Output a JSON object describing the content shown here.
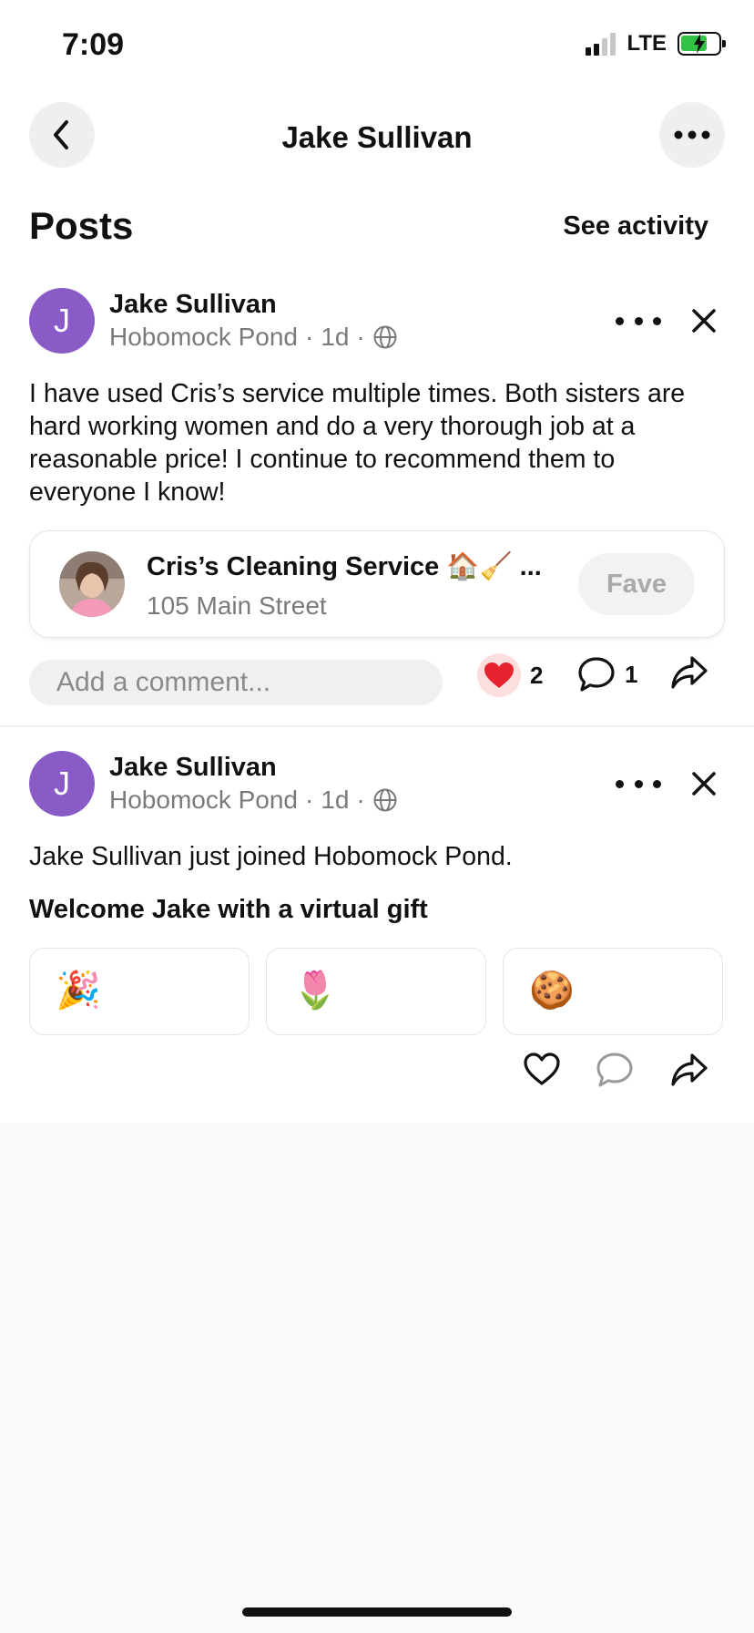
{
  "status_bar": {
    "time": "7:09",
    "network": "LTE"
  },
  "header": {
    "title": "Jake Sullivan",
    "back_icon": "chevron-left-icon",
    "more_icon": "ellipsis-icon"
  },
  "section": {
    "title": "Posts",
    "see_activity": "See activity"
  },
  "posts": [
    {
      "author": "Jake Sullivan",
      "avatar_initial": "J",
      "neighborhood": "Hobomock Pond",
      "time": "1d",
      "visibility_icon": "globe-icon",
      "body": "I have used Cris’s service multiple times. Both sisters are hard working women and do a very thorough job at a reasonable price! I continue to recommend them to everyone I know!",
      "business": {
        "name": "Cris’s Cleaning Service 🏠🧹 ...",
        "address": "105 Main Street",
        "fave_label": "Fave"
      },
      "comment_placeholder": "Add a comment...",
      "reaction_count": "2",
      "comment_count": "1"
    },
    {
      "author": "Jake Sullivan",
      "avatar_initial": "J",
      "neighborhood": "Hobomock Pond",
      "time": "1d",
      "visibility_icon": "globe-icon",
      "body": "Jake Sullivan just joined Hobomock Pond.",
      "gift_title": "Welcome Jake with a virtual gift",
      "gifts": [
        {
          "icon": "🎉",
          "name": "party-popper-icon"
        },
        {
          "icon": "🌷",
          "name": "tulip-icon"
        },
        {
          "icon": "🍪",
          "name": "cookie-icon"
        }
      ]
    }
  ],
  "colors": {
    "avatar": "#8a5bc7",
    "reaction_heart": "#e8232f",
    "background": "#fafafa"
  }
}
